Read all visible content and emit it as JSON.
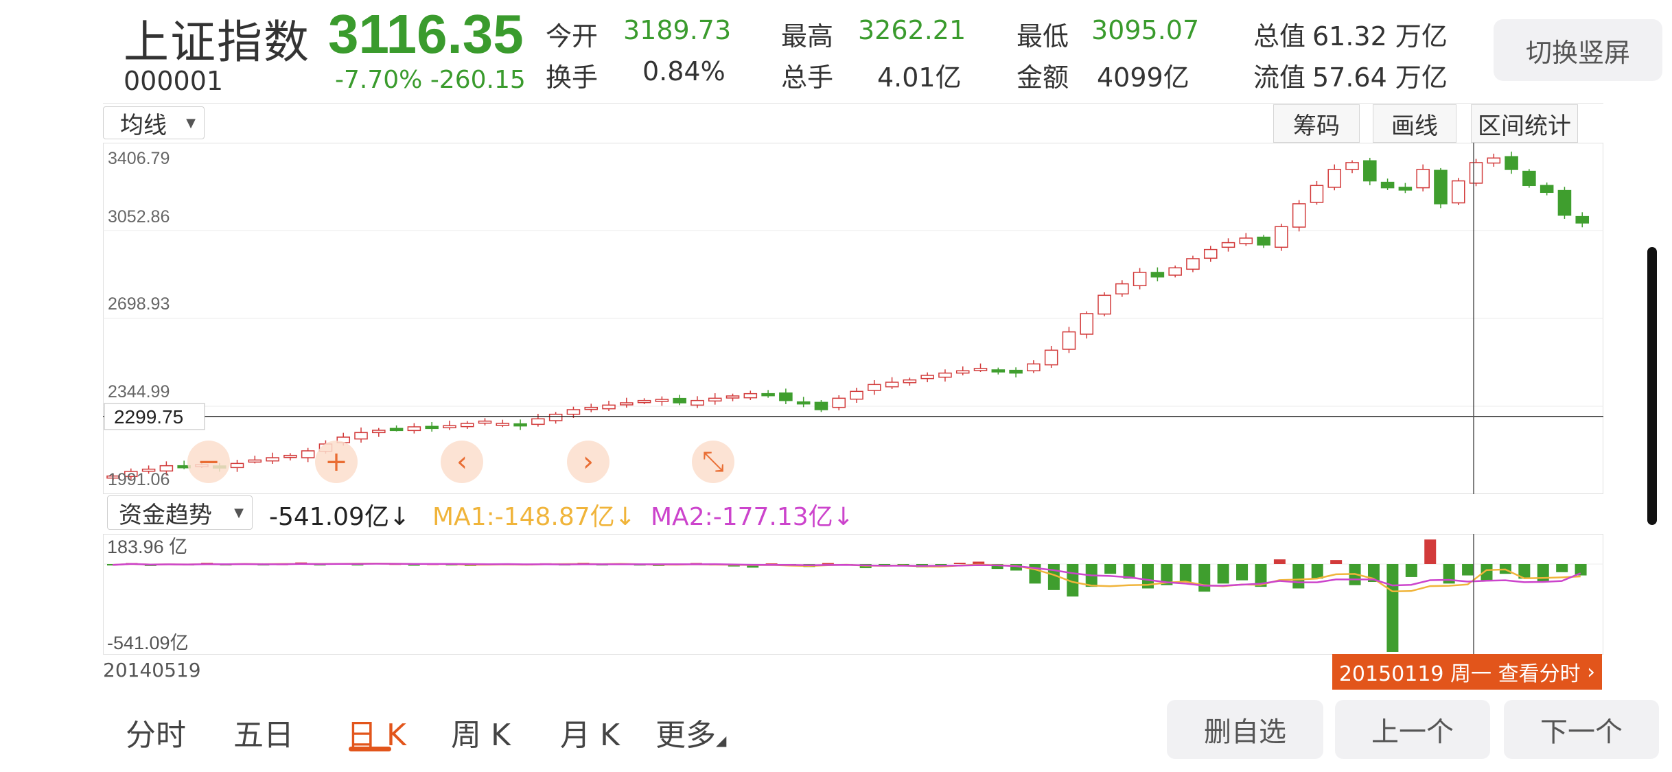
{
  "header": {
    "index_name": "上证指数",
    "index_code": "000001",
    "price": "3116.35",
    "change_pct": "-7.70%",
    "change_abs": "-260.15",
    "stats": [
      {
        "label": "今开",
        "value": "3189.73",
        "color": "green"
      },
      {
        "label": "最高",
        "value": "3262.21",
        "color": "green"
      },
      {
        "label": "最低",
        "value": "3095.07",
        "color": "green"
      },
      {
        "label": "总值",
        "value": "61.32 万亿",
        "color": "dark"
      },
      {
        "label": "换手",
        "value": "0.84%",
        "color": "dark"
      },
      {
        "label": "总手",
        "value": "4.01亿",
        "color": "dark"
      },
      {
        "label": "金额",
        "value": "4099亿",
        "color": "dark"
      },
      {
        "label": "流值",
        "value": "57.64 万亿",
        "color": "dark"
      }
    ],
    "orientation_button": "切换竖屏"
  },
  "toolbar": {
    "ma_dropdown": "均线",
    "chips_button": "筹码",
    "draw_button": "画线",
    "range_stats_button": "区间统计"
  },
  "price_axis": {
    "labels": [
      "3406.79",
      "3052.86",
      "2698.93",
      "2344.99",
      "1991.06"
    ],
    "crosshair_value": "2299.75"
  },
  "zoom_controls": {
    "zoom_out": "−",
    "zoom_in": "+",
    "pan_left": "‹",
    "pan_right": "›",
    "shrink": "⤡"
  },
  "fund_panel": {
    "dropdown": "资金趋势",
    "value": "-541.09亿",
    "value_arrow": "↓",
    "ma1": "MA1:-148.87亿",
    "ma1_arrow": "↓",
    "ma2": "MA2:-177.13亿",
    "ma2_arrow": "↓",
    "axis_top": "183.96 亿",
    "axis_bottom": "-541.09亿"
  },
  "date_range": {
    "start": "20140519",
    "selected_tag": "20150119 周一 查看分时",
    "tag_arrow": "›"
  },
  "bottom_tabs": [
    {
      "label": "分时"
    },
    {
      "label": "五日"
    },
    {
      "label": "日 K",
      "active": true
    },
    {
      "label": "周 K"
    },
    {
      "label": "月 K"
    },
    {
      "label": "更多"
    }
  ],
  "bottom_buttons": {
    "remove_watch": "删自选",
    "previous": "上一个",
    "next": "下一个"
  },
  "chart_data": {
    "type": "candlestick",
    "x_start": "20140519",
    "x_end": "20150119",
    "ylim": [
      1991.06,
      3406.79
    ],
    "colors": {
      "up": "#d23a3a",
      "down": "#3f9e2e",
      "ma1": "#f0b43a",
      "ma2": "#cc44cc"
    },
    "closes_approx": [
      2010,
      2030,
      2040,
      2055,
      2050,
      2060,
      2045,
      2065,
      2080,
      2090,
      2100,
      2120,
      2150,
      2180,
      2200,
      2210,
      2215,
      2225,
      2220,
      2230,
      2240,
      2250,
      2240,
      2230,
      2260,
      2280,
      2300,
      2310,
      2320,
      2330,
      2340,
      2345,
      2330,
      2340,
      2350,
      2360,
      2370,
      2365,
      2340,
      2330,
      2300,
      2350,
      2380,
      2410,
      2420,
      2430,
      2450,
      2460,
      2470,
      2480,
      2470,
      2460,
      2500,
      2560,
      2640,
      2720,
      2800,
      2850,
      2900,
      2880,
      2920,
      2960,
      3000,
      3030,
      3050,
      3020,
      3100,
      3200,
      3280,
      3350,
      3380,
      3300,
      3270,
      3260,
      3350,
      3200,
      3300,
      3380,
      3400,
      3350,
      3280,
      3250,
      3150,
      3116
    ],
    "fund_flow_approx": [
      -5,
      8,
      -12,
      3,
      -6,
      10,
      -4,
      5,
      -8,
      2,
      12,
      -3,
      6,
      -2,
      8,
      4,
      -10,
      3,
      -6,
      -12,
      5,
      2,
      -8,
      6,
      -4,
      10,
      -6,
      3,
      -9,
      -12,
      4,
      8,
      -6,
      -15,
      -22,
      5,
      -10,
      -18,
      8,
      -6,
      -25,
      -12,
      -8,
      -20,
      -14,
      10,
      18,
      -30,
      -40,
      -120,
      -160,
      -200,
      -140,
      -60,
      -90,
      -150,
      -130,
      -110,
      -170,
      -120,
      -100,
      -140,
      35,
      -150,
      -90,
      30,
      -130,
      -110,
      -541,
      -80,
      183,
      -120,
      -70,
      -100,
      -60,
      -90,
      -110,
      -50,
      -70
    ]
  }
}
